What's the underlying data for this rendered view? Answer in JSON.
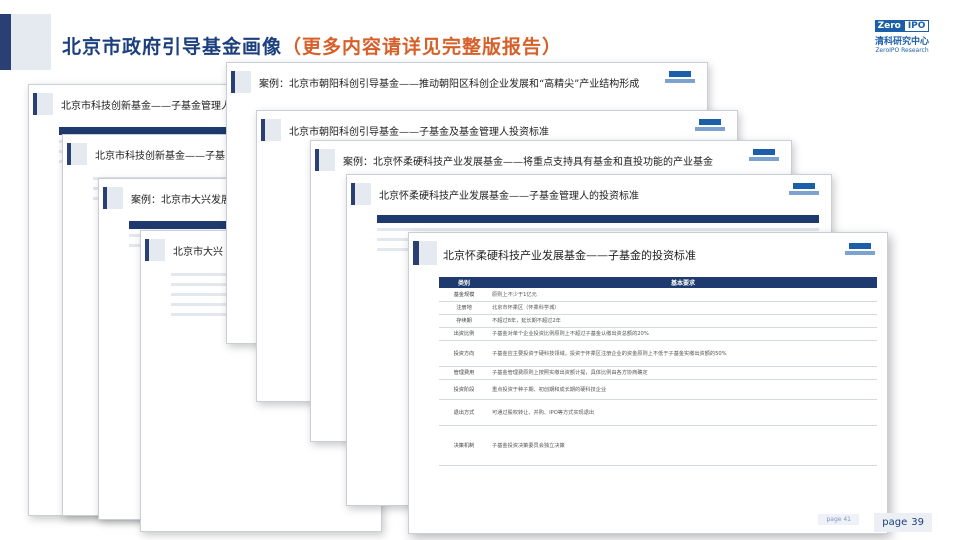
{
  "header": {
    "title_main": "北京市政府引导基金画像",
    "title_sub": "（更多内容请详见完整版报告）"
  },
  "logo": {
    "zero": "Zero",
    "ipo": "IPO",
    "cn": "清科研究中心",
    "en": "ZeroIPO Research"
  },
  "slides": [
    {
      "title": "北京市科技创新基金——子基金管理人"
    },
    {
      "title": "北京市科技创新基金——子基"
    },
    {
      "title": "案例：北京市大兴发展"
    },
    {
      "title": "北京市大兴"
    },
    {
      "title": "案例：北京市朝阳科创引导基金——推动朝阳区科创企业发展和“高精尖”产业结构形成"
    },
    {
      "title": "北京市朝阳科创引导基金——子基金及基金管理人投资标准"
    },
    {
      "title": "案例：北京怀柔硬科技产业发展基金——将重点支持具有基金和直投功能的产业基金"
    },
    {
      "title": "北京怀柔硬科技产业发展基金——子基金管理人的投资标准"
    }
  ],
  "main_slide": {
    "title": "北京怀柔硬科技产业发展基金——子基金的投资标准",
    "col_headers": [
      "类别",
      "基本要求"
    ],
    "rows": [
      {
        "k": "基金规模",
        "v": "原则上不少于1亿元"
      },
      {
        "k": "注册地",
        "v": "北京市怀柔区（怀柔科学城）"
      },
      {
        "k": "存续期",
        "v": "不超过8年，延长期不超过2年"
      },
      {
        "k": "出资比例",
        "v": "子基金对单个企业投资比例原则上不超过子基金认缴出资总额的20%"
      },
      {
        "k": "投资方向",
        "v": "子基金应主要投资于硬科技领域，投资于怀柔区注册企业的资金原则上不低于子基金实缴出资额的50%"
      },
      {
        "k": "管理费用",
        "v": "子基金管理费原则上按照实缴出资额计提，具体比例由各方协商确定"
      },
      {
        "k": "投资阶段",
        "v": "重点投资于种子期、初创期和成长期的硬科技企业"
      },
      {
        "k": "退出方式",
        "v": "可通过股权转让、并购、IPO等方式实现退出"
      },
      {
        "k": "决策机制",
        "v": "子基金投资决策委员会独立决策"
      }
    ],
    "page_label": "page 41"
  },
  "page": {
    "label": "page",
    "number": "39"
  }
}
